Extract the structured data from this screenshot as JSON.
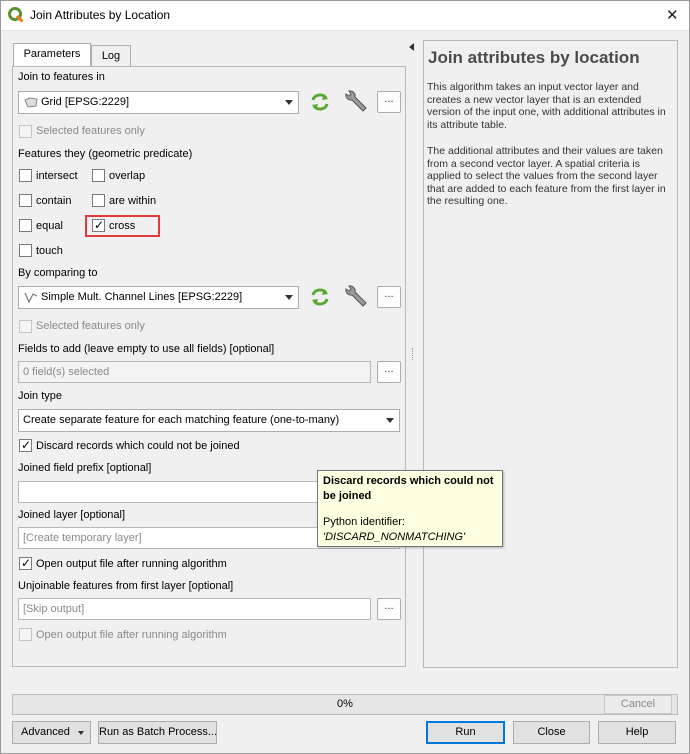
{
  "window": {
    "title": "Join Attributes by Location"
  },
  "tabs": [
    {
      "label": "Parameters"
    },
    {
      "label": "Log"
    }
  ],
  "params": {
    "join_to_label": "Join to features in",
    "join_to_value": "Grid [EPSG:2229]",
    "join_selected_only": "Selected features only",
    "predicate_label": "Features they (geometric predicate)",
    "predicates": {
      "intersect": "intersect",
      "overlap": "overlap",
      "contain": "contain",
      "within": "are within",
      "equal": "equal",
      "cross": "cross",
      "touch": "touch"
    },
    "comparing_label": "By comparing to",
    "comparing_value": "Simple Mult. Channel Lines [EPSG:2229]",
    "comparing_selected_only": "Selected features only",
    "fields_label": "Fields to add (leave empty to use all fields) [optional]",
    "fields_value": "0 field(s) selected",
    "join_type_label": "Join type",
    "join_type_value": "Create separate feature for each matching feature (one-to-many)",
    "discard_label": "Discard records which could not be joined",
    "prefix_label": "Joined field prefix [optional]",
    "joined_layer_label": "Joined layer [optional]",
    "joined_layer_placeholder": "[Create temporary layer]",
    "open_output_label": "Open output file after running algorithm",
    "unjoinable_label": "Unjoinable features from first layer [optional]",
    "unjoinable_placeholder": "[Skip output]",
    "open_output2_label": "Open output file after running algorithm",
    "dots": "..."
  },
  "help": {
    "title": "Join attributes by location",
    "p1": "This algorithm takes an input vector layer and creates a new vector layer that is an extended version of the input one, with additional attributes in its attribute table.",
    "p2": "The additional attributes and their values are taken from a second vector layer. A spatial criteria is applied to select the values from the second layer that are added to each feature from the first layer in the resulting one."
  },
  "tooltip": {
    "title": "Discard records which could not be joined",
    "line1": "Python identifier:",
    "line2": "'DISCARD_NONMATCHING'"
  },
  "progress": {
    "text": "0%",
    "value": 0
  },
  "buttons": {
    "cancel": "Cancel",
    "advanced": "Advanced",
    "batch": "Run as Batch Process...",
    "run": "Run",
    "close": "Close",
    "help": "Help"
  },
  "icons": [
    "qgis-logo-icon",
    "close-icon",
    "polygon-layer-icon",
    "line-layer-icon",
    "refresh-icon",
    "wrench-icon",
    "chevron-down-icon",
    "collapse-icon"
  ],
  "colors": {
    "highlight": "#e03a3e",
    "tooltip_bg": "#ffffe1",
    "help_title": "#4b4b4b",
    "iterate_green": "#5aa832"
  }
}
